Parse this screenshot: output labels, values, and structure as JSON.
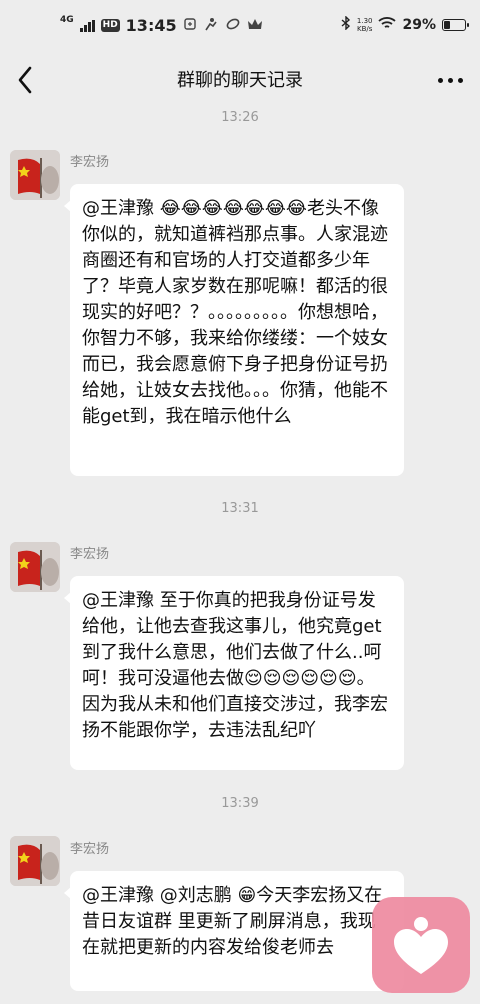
{
  "status_bar": {
    "network": "4G",
    "hd": "HD",
    "time": "13:45",
    "speed_value": "1.30",
    "speed_unit": "KB/s",
    "battery": "29%",
    "battery_level": 0.29
  },
  "header": {
    "title": "群聊的聊天记录"
  },
  "messages": [
    {
      "time": "13:26",
      "sender": "李宏扬",
      "text": "@王津豫 😂😂😂😂😂😂😂老头不像你似的，就知道裤裆那点事。人家混迹商圈还有和官场的人打交道都多少年了？毕竟人家岁数在那呢嘛！都活的很现实的好吧？？。。。。。。。。。你想想哈，你智力不够，我来给你缕缕：一个妓女而已，我会愿意俯下身子把身份证号扔给她，让妓女去找他。。。你猜，他能不能get到，我在暗示他什么"
    },
    {
      "time": "13:31",
      "sender": "李宏扬",
      "text": "@王津豫 至于你真的把我身份证号发给他，让他去查我这事儿，他究竟get到了我什么意思，他们去做了什么..呵呵！我可没逼他去做😌😌😌😌😌😌。因为我从未和他们直接交涉过，我李宏扬不能跟你学，去违法乱纪吖"
    },
    {
      "time": "13:39",
      "sender": "李宏扬",
      "text": "@王津豫 @刘志鹏 😁今天李宏扬又在 昔日友谊群 里更新了刷屏消息，我现在就把更新的内容发给俊老师去"
    }
  ]
}
